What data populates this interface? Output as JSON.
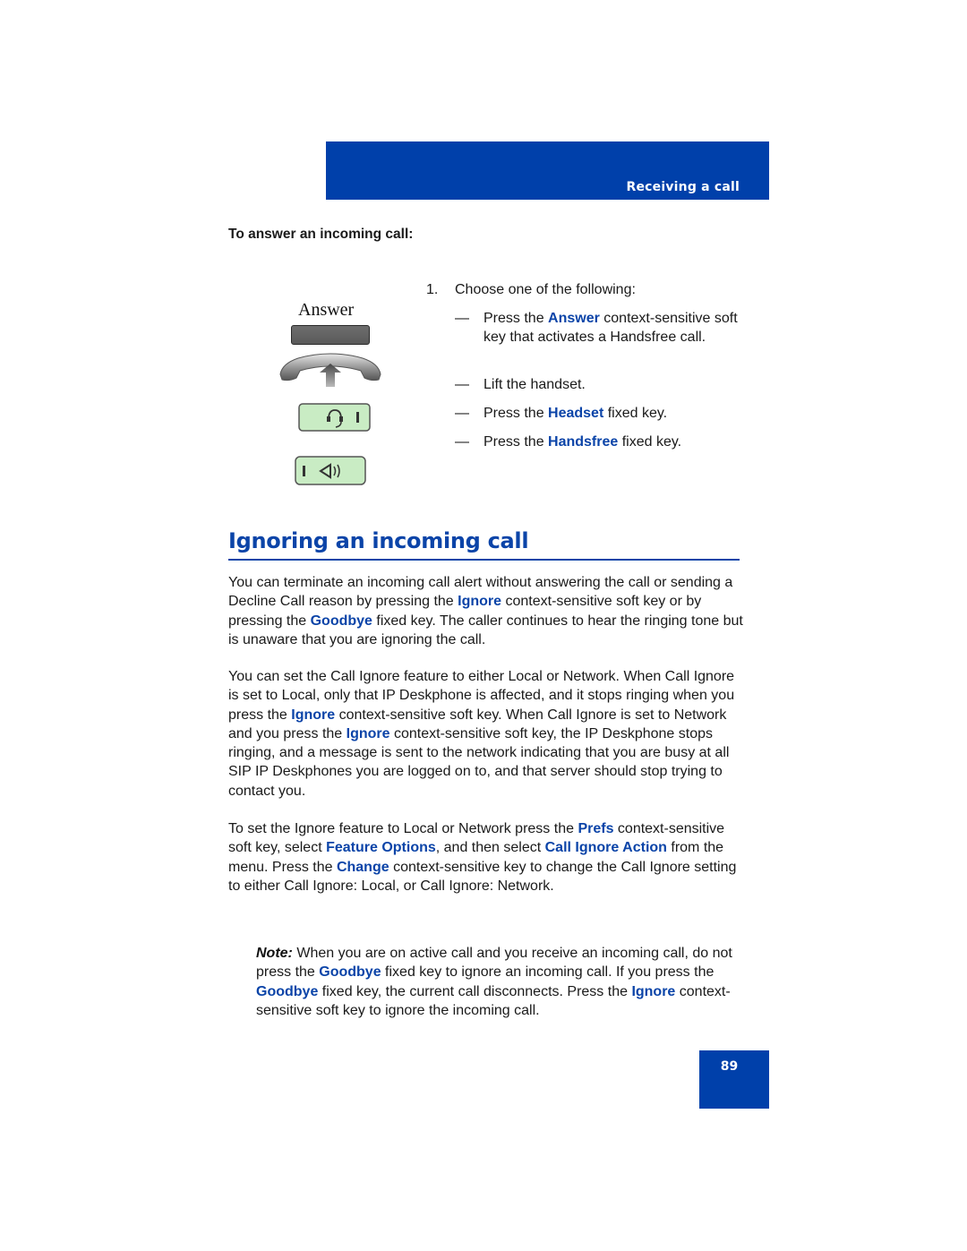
{
  "header": {
    "section_label": "Receiving a call",
    "color": "#0040aa"
  },
  "procedure": {
    "heading": "To answer an incoming call:",
    "soft_key_label": "Answer",
    "step_number": "1.",
    "step_text": "Choose one of the following:",
    "options": [
      {
        "dash": "—",
        "pre": "Press the ",
        "keyword": "Answer",
        "post": " context-sensitive soft key that activates a Handsfree call."
      },
      {
        "dash": "—",
        "pre": "Lift the handset.",
        "keyword": "",
        "post": ""
      },
      {
        "dash": "—",
        "pre": "Press the ",
        "keyword": "Headset",
        "post": " fixed key."
      },
      {
        "dash": "—",
        "pre": "Press the ",
        "keyword": "Handsfree",
        "post": " fixed key."
      }
    ],
    "icons": [
      "answer-softkey-icon",
      "handset-lift-icon",
      "headset-key-icon",
      "handsfree-key-icon"
    ]
  },
  "section": {
    "title": "Ignoring an incoming call",
    "accent_color": "#0b44a8",
    "paragraphs": [
      [
        {
          "t": "You can terminate an incoming call alert without answering the call or sending a Decline Call reason by pressing the "
        },
        {
          "k": "Ignore"
        },
        {
          "t": " context-sensitive soft key or by pressing the "
        },
        {
          "k": "Goodbye"
        },
        {
          "t": " fixed key. The caller continues to hear the ringing tone but is unaware that you are ignoring the call."
        }
      ],
      [
        {
          "t": "You can set the Call Ignore feature to either Local or Network. When Call Ignore is set to Local, only that IP Deskphone is affected, and it stops ringing when you press the "
        },
        {
          "k": "Ignore"
        },
        {
          "t": " context-sensitive soft key. When Call Ignore is set to Network and you press the "
        },
        {
          "k": "Ignore"
        },
        {
          "t": " context-sensitive soft key, the IP Deskphone stops ringing, and a message is sent to the network indicating that you are busy at all SIP IP Deskphones you are logged on to, and that server should stop trying to contact you."
        }
      ],
      [
        {
          "t": "To set the Ignore feature to Local or Network press the "
        },
        {
          "k": "Prefs"
        },
        {
          "t": " context-sensitive soft key, select "
        },
        {
          "k": "Feature Options"
        },
        {
          "t": ", and then select "
        },
        {
          "k": "Call Ignore Action"
        },
        {
          "t": " from the menu. Press the "
        },
        {
          "k": "Change"
        },
        {
          "t": " context-sensitive key to change the Call Ignore setting to either Call Ignore: Local, or Call Ignore: Network."
        }
      ]
    ],
    "note": {
      "label": "Note:",
      "segments": [
        {
          "t": "  When you are on active call and you receive an incoming call, do not press the "
        },
        {
          "k": "Goodbye"
        },
        {
          "t": " fixed key to ignore an incoming call. If you press the "
        },
        {
          "k": "Goodbye"
        },
        {
          "t": " fixed key, the current call disconnects. Press the "
        },
        {
          "k": "Ignore"
        },
        {
          "t": " context-sensitive soft key to ignore the incoming call."
        }
      ]
    }
  },
  "footer": {
    "page_number": "89"
  }
}
